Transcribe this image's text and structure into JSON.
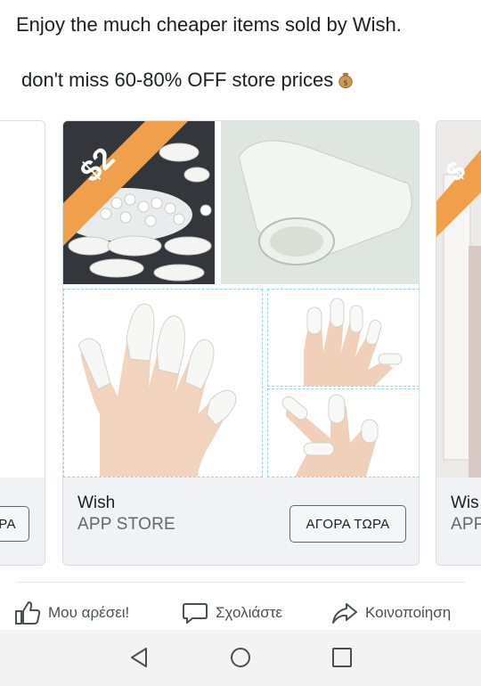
{
  "post": {
    "line1": "Enjoy the much cheaper items sold by Wish.",
    "line2": "don't miss 60-80% OFF store prices",
    "emoji": "money-bag-icon"
  },
  "carousel": {
    "left_card": {
      "cta_label": "PA"
    },
    "main_card": {
      "price_badge": "$2",
      "title": "Wish",
      "subtitle": "APP STORE",
      "cta_label": "ΑΓΟΡΑ ΤΩΡΑ"
    },
    "right_card": {
      "price_badge": "$",
      "title": "Wis",
      "subtitle": "APP"
    }
  },
  "actions": {
    "like": "Μου αρέσει!",
    "comment": "Σχολιάστε",
    "share": "Κοινοποίηση"
  },
  "colors": {
    "badge": "#f0a04b",
    "accent_dash": "#9ad2ea"
  }
}
